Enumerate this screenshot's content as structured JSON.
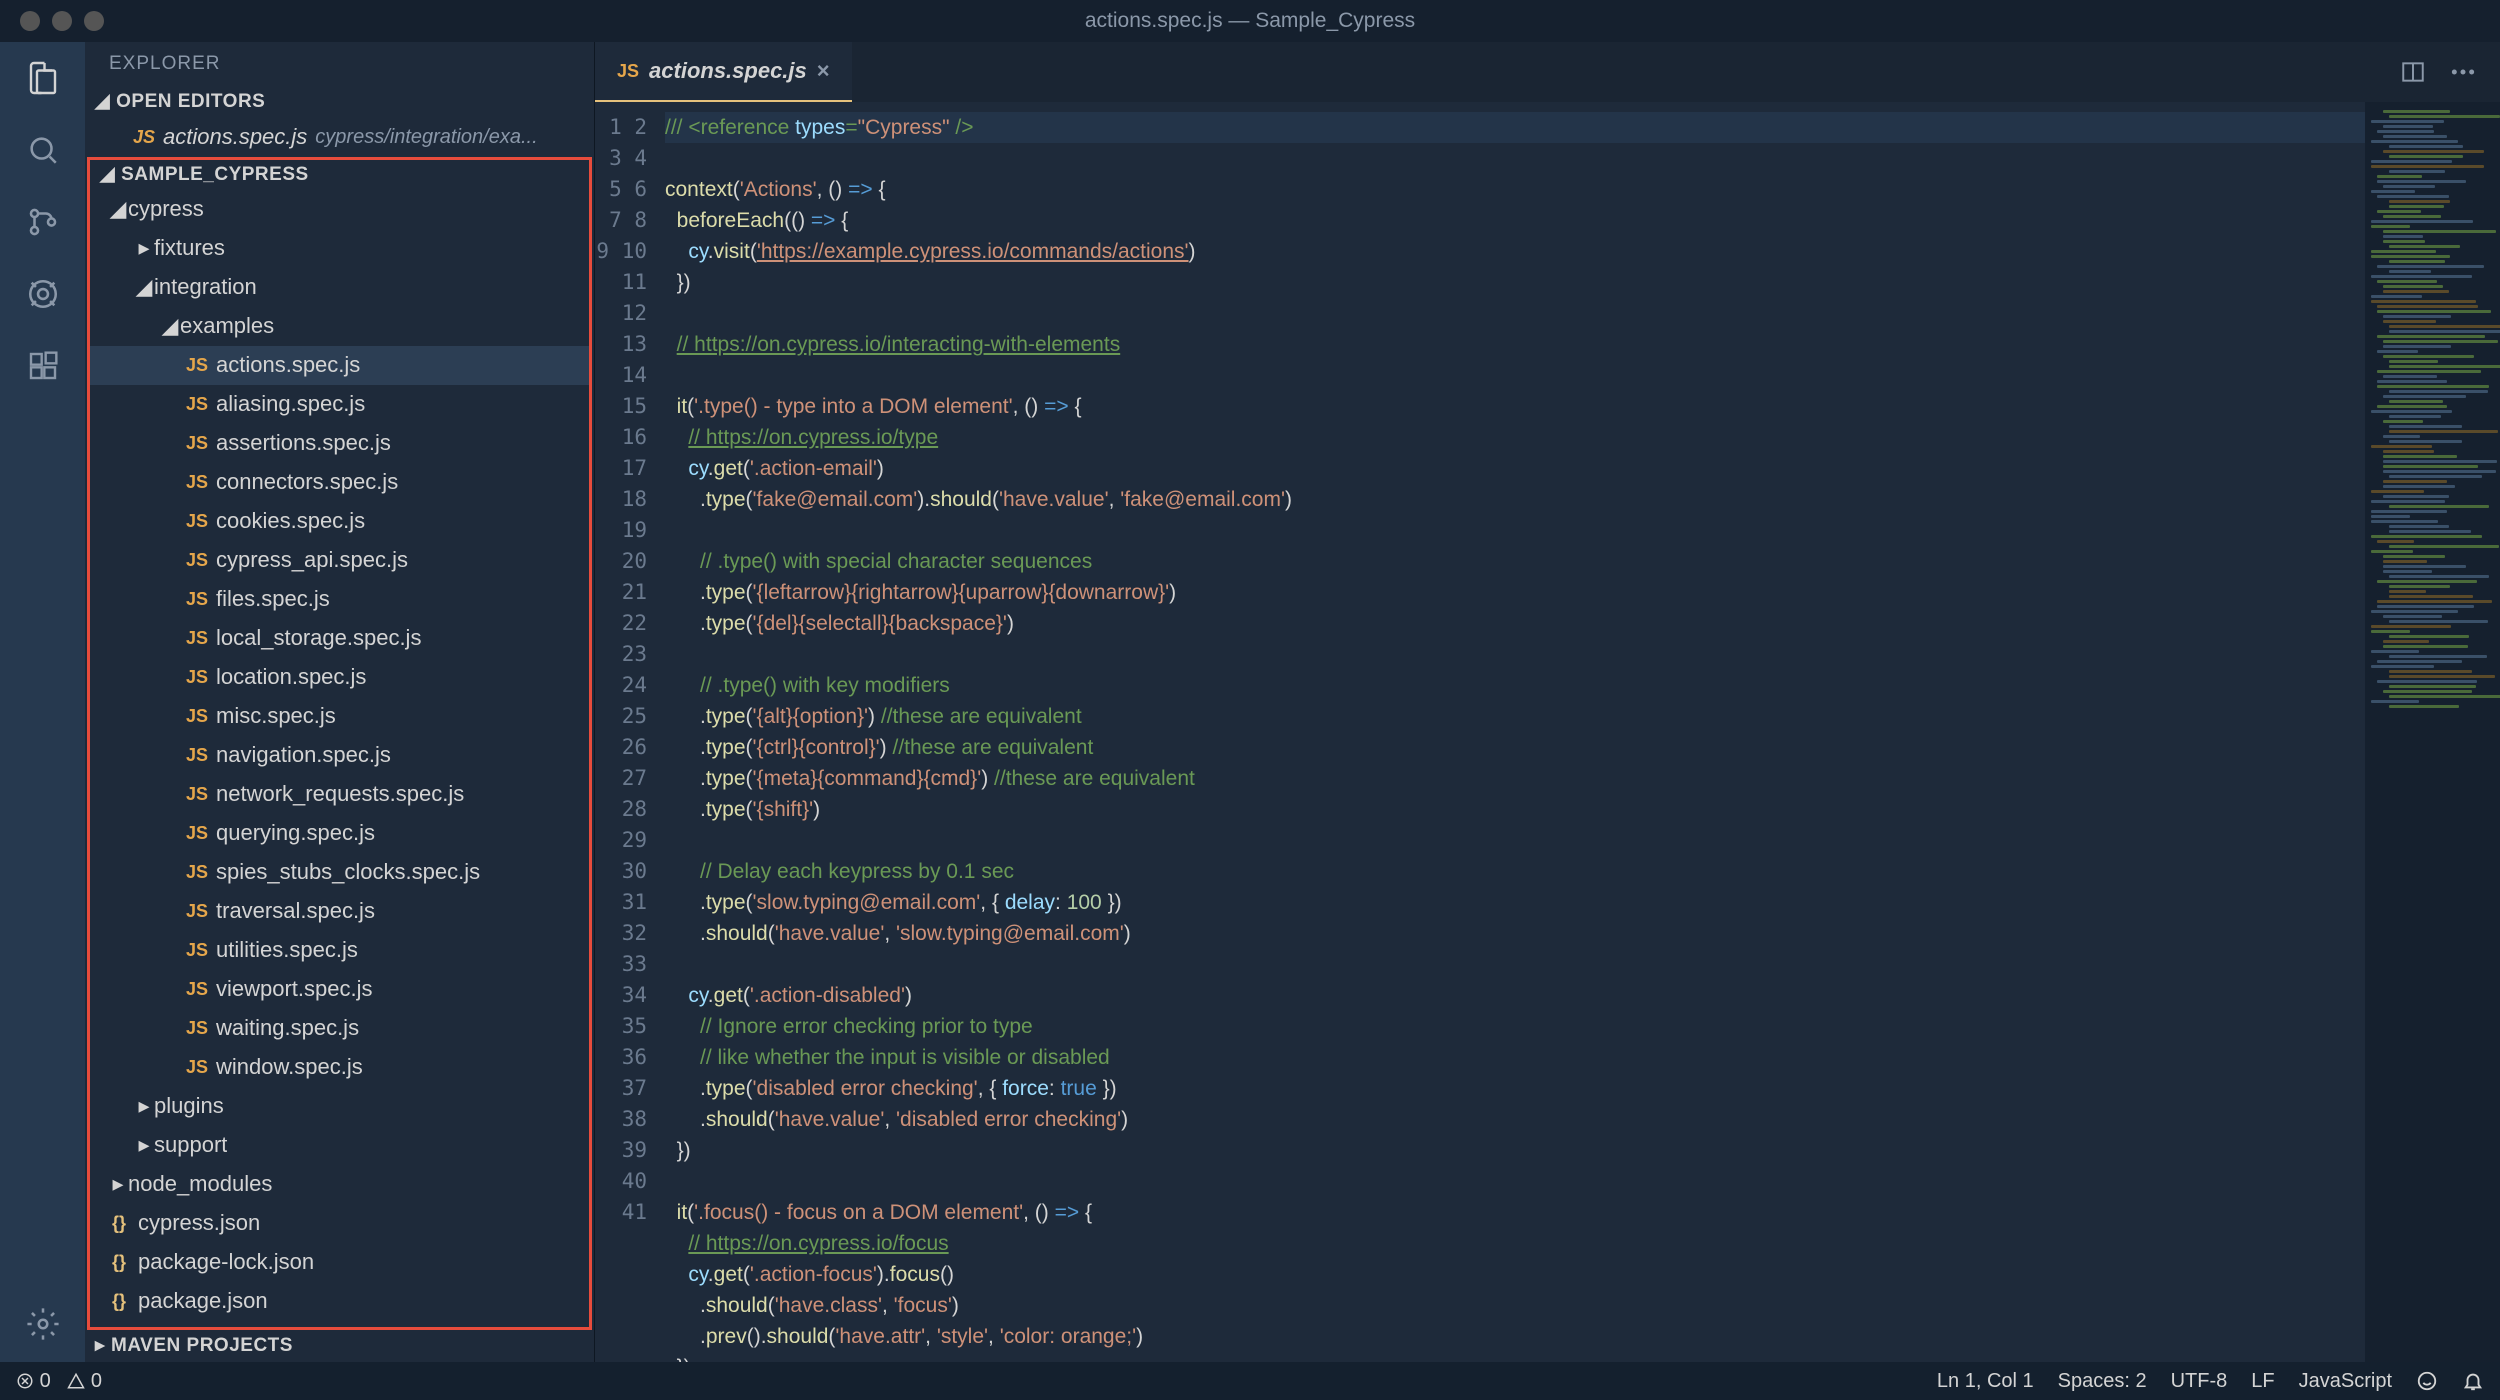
{
  "titlebar": {
    "title": "actions.spec.js — Sample_Cypress",
    "traffic_colors": [
      "#555",
      "#555",
      "#555"
    ]
  },
  "activity": {
    "items": [
      "files-icon",
      "search-icon",
      "source-control-icon",
      "debug-icon",
      "extensions-icon"
    ],
    "bottom": [
      "gear-icon"
    ]
  },
  "sidebar": {
    "title": "EXPLORER",
    "open_editors_label": "OPEN EDITORS",
    "open_editors": [
      {
        "name": "actions.spec.js",
        "path": "cypress/integration/exa...",
        "icon": "JS"
      }
    ],
    "project_label": "SAMPLE_CYPRESS",
    "tree": {
      "cypress": {
        "fixtures": {},
        "integration": {
          "examples": {
            "files": [
              "actions.spec.js",
              "aliasing.spec.js",
              "assertions.spec.js",
              "connectors.spec.js",
              "cookies.spec.js",
              "cypress_api.spec.js",
              "files.spec.js",
              "local_storage.spec.js",
              "location.spec.js",
              "misc.spec.js",
              "navigation.spec.js",
              "network_requests.spec.js",
              "querying.spec.js",
              "spies_stubs_clocks.spec.js",
              "traversal.spec.js",
              "utilities.spec.js",
              "viewport.spec.js",
              "waiting.spec.js",
              "window.spec.js"
            ]
          }
        },
        "plugins": {},
        "support": {}
      },
      "node_modules": {},
      "root_files": [
        {
          "name": "cypress.json",
          "icon": "{}"
        },
        {
          "name": "package-lock.json",
          "icon": "{}"
        },
        {
          "name": "package.json",
          "icon": "{}"
        }
      ]
    },
    "other_section": "MAVEN PROJECTS"
  },
  "tabs": {
    "active": {
      "name": "actions.spec.js",
      "icon": "JS"
    }
  },
  "code": {
    "line_start": 1,
    "line_end": 41,
    "lines": [
      {
        "hl": true,
        "seg": [
          [
            "c",
            "/// "
          ],
          [
            "c",
            "<reference "
          ],
          [
            "o",
            "types"
          ],
          [
            "c",
            "="
          ],
          [
            "s",
            "\"Cypress\""
          ],
          [
            "c",
            " />"
          ]
        ]
      },
      {
        "seg": []
      },
      {
        "seg": [
          [
            "f",
            "context"
          ],
          [
            "w",
            "("
          ],
          [
            "s",
            "'Actions'"
          ],
          [
            "w",
            ", () "
          ],
          [
            "b",
            "=>"
          ],
          [
            "w",
            " {"
          ]
        ]
      },
      {
        "seg": [
          [
            "w",
            "  "
          ],
          [
            "f",
            "beforeEach"
          ],
          [
            "w",
            "(() "
          ],
          [
            "b",
            "=>"
          ],
          [
            "w",
            " {"
          ]
        ]
      },
      {
        "seg": [
          [
            "w",
            "    "
          ],
          [
            "o",
            "cy"
          ],
          [
            "w",
            "."
          ],
          [
            "f",
            "visit"
          ],
          [
            "w",
            "("
          ],
          [
            "s u",
            "'https://example.cypress.io/commands/actions'"
          ],
          [
            "w",
            ")"
          ]
        ]
      },
      {
        "seg": [
          [
            "w",
            "  })"
          ]
        ]
      },
      {
        "seg": []
      },
      {
        "seg": [
          [
            "w",
            "  "
          ],
          [
            "c u",
            "// https://on.cypress.io/interacting-with-elements"
          ]
        ]
      },
      {
        "seg": []
      },
      {
        "seg": [
          [
            "w",
            "  "
          ],
          [
            "f",
            "it"
          ],
          [
            "w",
            "("
          ],
          [
            "s",
            "'.type() - type into a DOM element'"
          ],
          [
            "w",
            ", () "
          ],
          [
            "b",
            "=>"
          ],
          [
            "w",
            " {"
          ]
        ]
      },
      {
        "seg": [
          [
            "w",
            "    "
          ],
          [
            "c u",
            "// https://on.cypress.io/type"
          ]
        ]
      },
      {
        "seg": [
          [
            "w",
            "    "
          ],
          [
            "o",
            "cy"
          ],
          [
            "w",
            "."
          ],
          [
            "f",
            "get"
          ],
          [
            "w",
            "("
          ],
          [
            "s",
            "'.action-email'"
          ],
          [
            "w",
            ")"
          ]
        ]
      },
      {
        "seg": [
          [
            "w",
            "      ."
          ],
          [
            "f",
            "type"
          ],
          [
            "w",
            "("
          ],
          [
            "s",
            "'fake@email.com'"
          ],
          [
            "w",
            ")."
          ],
          [
            "f",
            "should"
          ],
          [
            "w",
            "("
          ],
          [
            "s",
            "'have.value'"
          ],
          [
            "w",
            ", "
          ],
          [
            "s",
            "'fake@email.com'"
          ],
          [
            "w",
            ")"
          ]
        ]
      },
      {
        "seg": []
      },
      {
        "seg": [
          [
            "w",
            "      "
          ],
          [
            "c",
            "// .type() with special character sequences"
          ]
        ]
      },
      {
        "seg": [
          [
            "w",
            "      ."
          ],
          [
            "f",
            "type"
          ],
          [
            "w",
            "("
          ],
          [
            "s",
            "'{leftarrow}{rightarrow}{uparrow}{downarrow}'"
          ],
          [
            "w",
            ")"
          ]
        ]
      },
      {
        "seg": [
          [
            "w",
            "      ."
          ],
          [
            "f",
            "type"
          ],
          [
            "w",
            "("
          ],
          [
            "s",
            "'{del}{selectall}{backspace}'"
          ],
          [
            "w",
            ")"
          ]
        ]
      },
      {
        "seg": []
      },
      {
        "seg": [
          [
            "w",
            "      "
          ],
          [
            "c",
            "// .type() with key modifiers"
          ]
        ]
      },
      {
        "seg": [
          [
            "w",
            "      ."
          ],
          [
            "f",
            "type"
          ],
          [
            "w",
            "("
          ],
          [
            "s",
            "'{alt}{option}'"
          ],
          [
            "w",
            ") "
          ],
          [
            "c",
            "//these are equivalent"
          ]
        ]
      },
      {
        "seg": [
          [
            "w",
            "      ."
          ],
          [
            "f",
            "type"
          ],
          [
            "w",
            "("
          ],
          [
            "s",
            "'{ctrl}{control}'"
          ],
          [
            "w",
            ") "
          ],
          [
            "c",
            "//these are equivalent"
          ]
        ]
      },
      {
        "seg": [
          [
            "w",
            "      ."
          ],
          [
            "f",
            "type"
          ],
          [
            "w",
            "("
          ],
          [
            "s",
            "'{meta}{command}{cmd}'"
          ],
          [
            "w",
            ") "
          ],
          [
            "c",
            "//these are equivalent"
          ]
        ]
      },
      {
        "seg": [
          [
            "w",
            "      ."
          ],
          [
            "f",
            "type"
          ],
          [
            "w",
            "("
          ],
          [
            "s",
            "'{shift}'"
          ],
          [
            "w",
            ")"
          ]
        ]
      },
      {
        "seg": []
      },
      {
        "seg": [
          [
            "w",
            "      "
          ],
          [
            "c",
            "// Delay each keypress by 0.1 sec"
          ]
        ]
      },
      {
        "seg": [
          [
            "w",
            "      ."
          ],
          [
            "f",
            "type"
          ],
          [
            "w",
            "("
          ],
          [
            "s",
            "'slow.typing@email.com'"
          ],
          [
            "w",
            ", { "
          ],
          [
            "o",
            "delay"
          ],
          [
            "w",
            ": "
          ],
          [
            "n",
            "100"
          ],
          [
            "w",
            " })"
          ]
        ]
      },
      {
        "seg": [
          [
            "w",
            "      ."
          ],
          [
            "f",
            "should"
          ],
          [
            "w",
            "("
          ],
          [
            "s",
            "'have.value'"
          ],
          [
            "w",
            ", "
          ],
          [
            "s",
            "'slow.typing@email.com'"
          ],
          [
            "w",
            ")"
          ]
        ]
      },
      {
        "seg": []
      },
      {
        "seg": [
          [
            "w",
            "    "
          ],
          [
            "o",
            "cy"
          ],
          [
            "w",
            "."
          ],
          [
            "f",
            "get"
          ],
          [
            "w",
            "("
          ],
          [
            "s",
            "'.action-disabled'"
          ],
          [
            "w",
            ")"
          ]
        ]
      },
      {
        "seg": [
          [
            "w",
            "      "
          ],
          [
            "c",
            "// Ignore error checking prior to type"
          ]
        ]
      },
      {
        "seg": [
          [
            "w",
            "      "
          ],
          [
            "c",
            "// like whether the input is visible or disabled"
          ]
        ]
      },
      {
        "seg": [
          [
            "w",
            "      ."
          ],
          [
            "f",
            "type"
          ],
          [
            "w",
            "("
          ],
          [
            "s",
            "'disabled error checking'"
          ],
          [
            "w",
            ", { "
          ],
          [
            "o",
            "force"
          ],
          [
            "w",
            ": "
          ],
          [
            "b",
            "true"
          ],
          [
            "w",
            " })"
          ]
        ]
      },
      {
        "seg": [
          [
            "w",
            "      ."
          ],
          [
            "f",
            "should"
          ],
          [
            "w",
            "("
          ],
          [
            "s",
            "'have.value'"
          ],
          [
            "w",
            ", "
          ],
          [
            "s",
            "'disabled error checking'"
          ],
          [
            "w",
            ")"
          ]
        ]
      },
      {
        "seg": [
          [
            "w",
            "  })"
          ]
        ]
      },
      {
        "seg": []
      },
      {
        "seg": [
          [
            "w",
            "  "
          ],
          [
            "f",
            "it"
          ],
          [
            "w",
            "("
          ],
          [
            "s",
            "'.focus() - focus on a DOM element'"
          ],
          [
            "w",
            ", () "
          ],
          [
            "b",
            "=>"
          ],
          [
            "w",
            " {"
          ]
        ]
      },
      {
        "seg": [
          [
            "w",
            "    "
          ],
          [
            "c u",
            "// https://on.cypress.io/focus"
          ]
        ]
      },
      {
        "seg": [
          [
            "w",
            "    "
          ],
          [
            "o",
            "cy"
          ],
          [
            "w",
            "."
          ],
          [
            "f",
            "get"
          ],
          [
            "w",
            "("
          ],
          [
            "s",
            "'.action-focus'"
          ],
          [
            "w",
            ")."
          ],
          [
            "f",
            "focus"
          ],
          [
            "w",
            "()"
          ]
        ]
      },
      {
        "seg": [
          [
            "w",
            "      ."
          ],
          [
            "f",
            "should"
          ],
          [
            "w",
            "("
          ],
          [
            "s",
            "'have.class'"
          ],
          [
            "w",
            ", "
          ],
          [
            "s",
            "'focus'"
          ],
          [
            "w",
            ")"
          ]
        ]
      },
      {
        "seg": [
          [
            "w",
            "      ."
          ],
          [
            "f",
            "prev"
          ],
          [
            "w",
            "()."
          ],
          [
            "f",
            "should"
          ],
          [
            "w",
            "("
          ],
          [
            "s",
            "'have.attr'"
          ],
          [
            "w",
            ", "
          ],
          [
            "s",
            "'style'"
          ],
          [
            "w",
            ", "
          ],
          [
            "s",
            "'color: orange;'"
          ],
          [
            "w",
            ")"
          ]
        ]
      },
      {
        "seg": [
          [
            "w",
            "  })"
          ]
        ]
      }
    ]
  },
  "status": {
    "errors": "0",
    "warnings": "0",
    "cursor": "Ln 1, Col 1",
    "spaces": "Spaces: 2",
    "encoding": "UTF-8",
    "eol": "LF",
    "lang": "JavaScript"
  }
}
